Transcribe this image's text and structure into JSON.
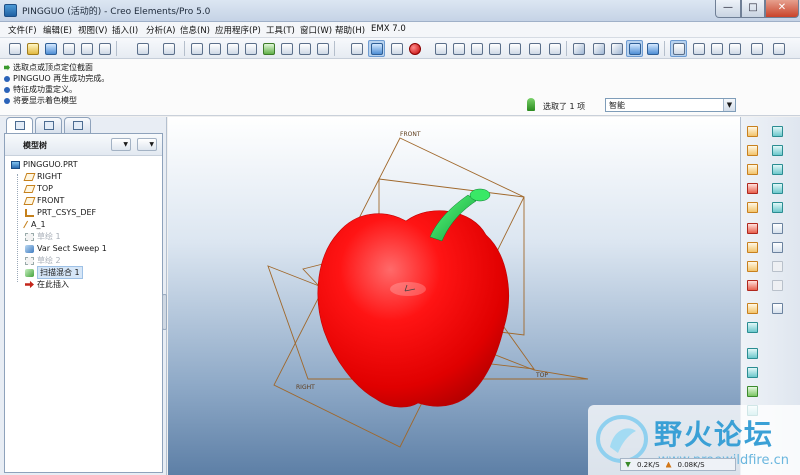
{
  "window": {
    "title": "PINGGUO (活动的) - Creo Elements/Pro 5.0",
    "controls": {
      "minimize": "—",
      "maximize": "□",
      "close": "✕"
    }
  },
  "menu": {
    "items": [
      "文件(F)",
      "编辑(E)",
      "视图(V)",
      "插入(I)",
      "分析(A)",
      "信息(N)",
      "应用程序(P)",
      "工具(T)",
      "窗口(W)",
      "帮助(H)",
      "EMX 7.0"
    ]
  },
  "messages": [
    {
      "text": "选取点或顶点定位截面",
      "bullet": "green"
    },
    {
      "text": "PINGGUO 再生成功完成。",
      "bullet": "blue"
    },
    {
      "text": "特征成功重定义。",
      "bullet": "blue"
    },
    {
      "text": "将要显示着色模型",
      "bullet": "blue"
    }
  ],
  "selection": {
    "status": "选取了 1 项",
    "filter_value": "智能"
  },
  "navigator": {
    "header_label": "模型树",
    "tree": [
      {
        "label": "PINGGUO.PRT",
        "icon": "part-icon",
        "state": "normal"
      },
      {
        "label": "RIGHT",
        "icon": "datum-plane-icon",
        "state": "normal"
      },
      {
        "label": "TOP",
        "icon": "datum-plane-icon",
        "state": "normal"
      },
      {
        "label": "FRONT",
        "icon": "datum-plane-icon",
        "state": "normal"
      },
      {
        "label": "PRT_CSYS_DEF",
        "icon": "csys-icon",
        "state": "normal"
      },
      {
        "label": "A_1",
        "icon": "datum-axis-icon",
        "state": "normal"
      },
      {
        "label": "草绘 1",
        "icon": "sketch-icon",
        "state": "dim"
      },
      {
        "label": "Var Sect Sweep 1",
        "icon": "sweep-icon",
        "state": "normal"
      },
      {
        "label": "草绘 2",
        "icon": "sketch-icon",
        "state": "dim"
      },
      {
        "label": "扫描混合 1",
        "icon": "blend-icon",
        "state": "highlight"
      },
      {
        "label": "在此插入",
        "icon": "insert-here-icon",
        "state": "normal"
      }
    ]
  },
  "viewport": {
    "datum_labels": {
      "front": "FRONT",
      "top": "TOP",
      "right": "RIGHT"
    },
    "colors": {
      "apple": "#ff0d0d",
      "stem": "#1ed760",
      "datum": "#a0682b"
    }
  },
  "status": {
    "download": "0.2K/S",
    "upload": "0.08K/S"
  },
  "watermark": {
    "name": "野火论坛",
    "url": "www.proewildfire.cn"
  }
}
